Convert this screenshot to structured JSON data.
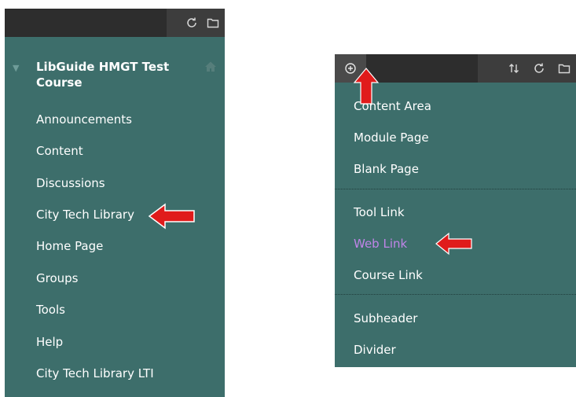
{
  "left_panel": {
    "course_title": "LibGuide HMGT Test Course",
    "nav_items": [
      {
        "label": "Announcements"
      },
      {
        "label": "Content"
      },
      {
        "label": "Discussions"
      },
      {
        "label": "City Tech Library"
      },
      {
        "label": "Home Page"
      },
      {
        "label": "Groups"
      },
      {
        "label": "Tools"
      },
      {
        "label": "Help"
      },
      {
        "label": "City Tech Library LTI"
      }
    ]
  },
  "right_panel": {
    "menu_items": [
      {
        "label": "Content Area"
      },
      {
        "label": "Module Page"
      },
      {
        "label": "Blank Page"
      },
      {
        "label": "Tool Link"
      },
      {
        "label": "Web Link"
      },
      {
        "label": "Course Link"
      },
      {
        "label": "Subheader"
      },
      {
        "label": "Divider"
      }
    ]
  },
  "colors": {
    "panel_bg": "#3d6e6b",
    "toolbar_bg": "#2d2d2d",
    "highlight_text": "#c084e8",
    "arrow_red": "#e01b1b"
  },
  "icons": [
    "refresh-icon",
    "folder-icon",
    "home-icon",
    "plus-circle-icon",
    "sort-icon",
    "red-arrow"
  ]
}
